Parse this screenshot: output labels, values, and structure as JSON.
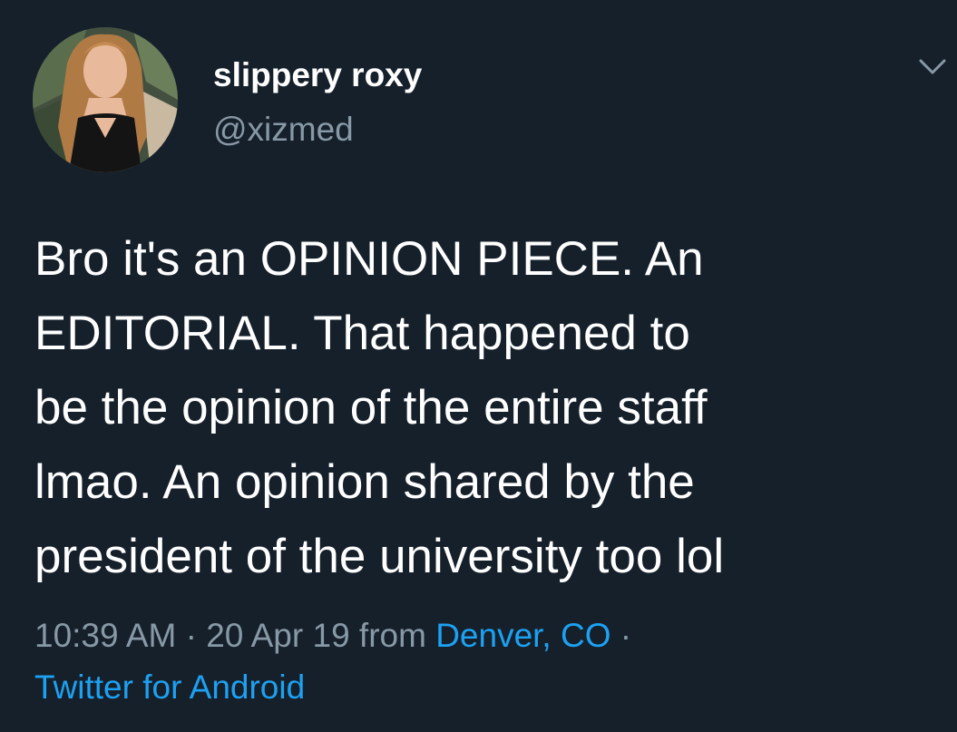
{
  "author": {
    "display_name": "slippery roxy",
    "handle": "@xizmed"
  },
  "tweet": {
    "text_lines": [
      "Bro it's an OPINION PIECE. An",
      "EDITORIAL. That happened to",
      "be the opinion of the entire staff",
      "lmao. An opinion shared by the",
      "president of the university too lol"
    ]
  },
  "meta": {
    "time": "10:39 AM",
    "sep1": " · ",
    "date": "20 Apr 19",
    "from_label": " from ",
    "location": "Denver, CO",
    "sep2": " ·",
    "client": "Twitter for Android"
  },
  "icons": {
    "more": "chevron-down-icon",
    "avatar": "profile-photo"
  },
  "colors": {
    "background": "#15202b",
    "text": "#ffffff",
    "secondary": "#8899a6",
    "link": "#1da1f2"
  }
}
